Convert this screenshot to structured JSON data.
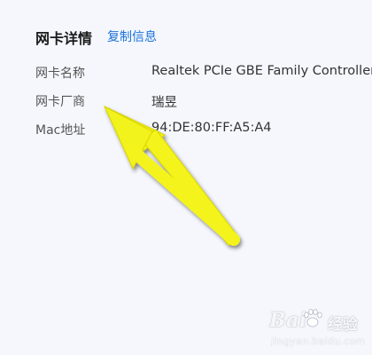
{
  "section": {
    "title": "网卡详情",
    "copy_label": "复制信息"
  },
  "rows": [
    {
      "label": "网卡名称",
      "value": "Realtek PCIe GBE Family Controller"
    },
    {
      "label": "网卡厂商",
      "value": "瑞昱"
    },
    {
      "label": "Mac地址",
      "value": "94:DE:80:FF:A5:A4"
    }
  ],
  "annotation": {
    "arrow_color": "#f4f41a",
    "arrow_icon": "yellow-pointer-arrow"
  },
  "watermark": {
    "brand_left": "Bai",
    "brand_right": "经验",
    "url": "jingyan.baidu.com"
  }
}
